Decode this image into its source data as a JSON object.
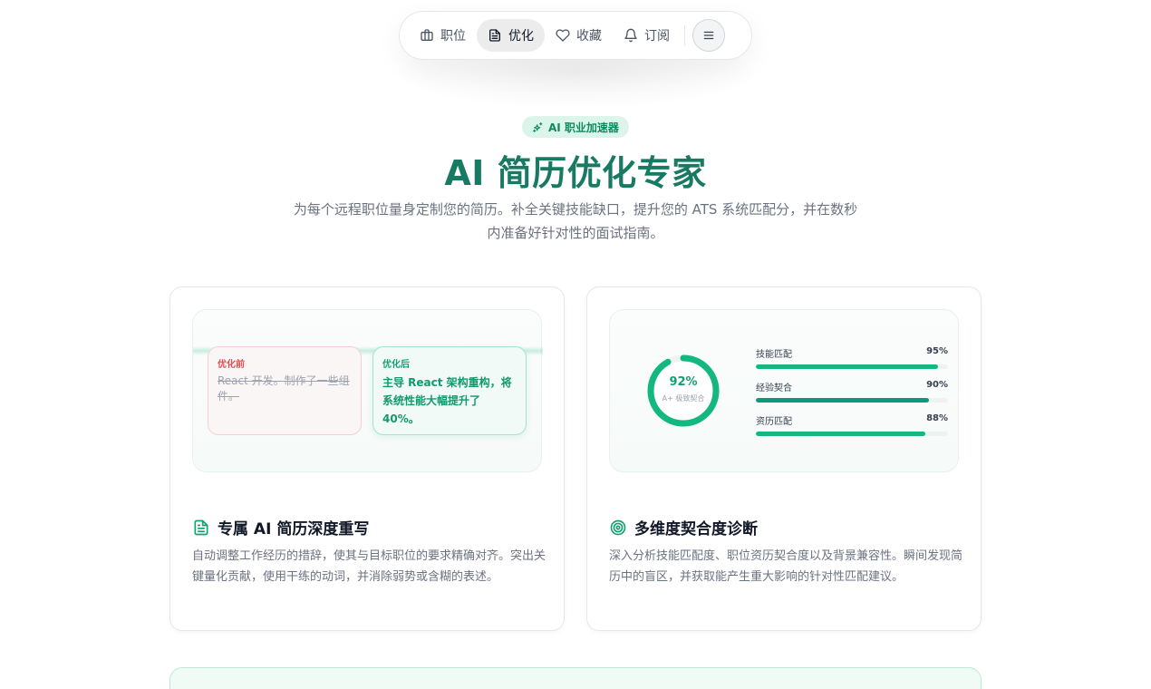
{
  "nav": {
    "items": [
      {
        "label": "职位",
        "icon": "briefcase-icon"
      },
      {
        "label": "优化",
        "icon": "document-icon",
        "active": true
      },
      {
        "label": "收藏",
        "icon": "heart-icon"
      },
      {
        "label": "订阅",
        "icon": "bell-icon"
      }
    ],
    "menu_icon": "menu-icon"
  },
  "hero": {
    "badge": "AI 职业加速器",
    "title": "AI 简历优化专家",
    "subtitle_line1": "为每个远程职位量身定制您的简历。补全关键技能缺口，提升您的 ATS 系统匹配分，并在数秒",
    "subtitle_line2": "内准备好针对性的面试指南。"
  },
  "cards": {
    "rewrite": {
      "before_label": "优化前",
      "before_text": "React 开发。制作了一些组件。",
      "after_label": "优化后",
      "after_text": "主导 React 架构重构，将系统性能大幅提升了 40%。",
      "title": "专属 AI 简历深度重写",
      "description": "自动调整工作经历的措辞，使其与目标职位的要求精确对齐。突出关键量化贡献，使用干练的动词，并消除弱势或含糊的表述。",
      "icon": "document-icon"
    },
    "diagnosis": {
      "score": "92%",
      "score_value": 0.92,
      "grade": "A+ 极致契合",
      "bars": [
        {
          "label": "技能匹配",
          "pct": "95%",
          "value": 0.95
        },
        {
          "label": "经验契合",
          "pct": "90%",
          "value": 0.9
        },
        {
          "label": "资历匹配",
          "pct": "88%",
          "value": 0.88
        }
      ],
      "title": "多维度契合度诊断",
      "description": "深入分析技能匹配度、职位资历契合度以及背景兼容性。瞬间发现简历中的盲区，并获取能产生重大影响的针对性匹配建议。",
      "icon": "target-icon"
    }
  },
  "colors": {
    "accent": "#13b780",
    "title": "#187a62",
    "before": "#e05050",
    "bar_dark": "#0e9a7a"
  }
}
